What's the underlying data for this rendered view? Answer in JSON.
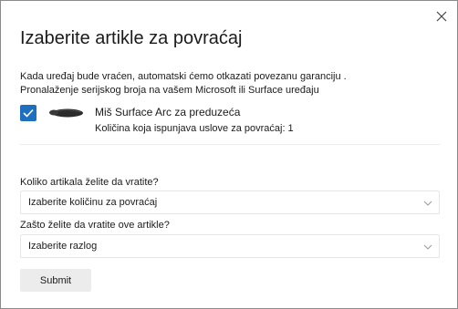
{
  "dialog": {
    "title": "Izaberite artikle za povraćaj",
    "close_icon": "close-icon",
    "description_line1": "Kada uređaj bude vraćen, automatski ćemo otkazati povezanu garanciju .",
    "description_line2": "Pronalaženje serijskog broja na vašem Microsoft ili Surface uređaju"
  },
  "item": {
    "checked": true,
    "image_icon": "mouse-icon",
    "name": "Miš Surface Arc za preduzeća",
    "quantity_text": "Količina koja ispunjava uslove za povraćaj: 1"
  },
  "quantity_field": {
    "label": "Koliko artikala želite da vratite?",
    "value": "Izaberite količinu za povraćaj"
  },
  "reason_field": {
    "label": "Zašto želite da vratite ove artikle?",
    "value": "Izaberite razlog"
  },
  "submit_label": "Submit",
  "colors": {
    "accent": "#1f6fbf",
    "button_bg": "#ececec",
    "border": "#8a8a8a"
  }
}
